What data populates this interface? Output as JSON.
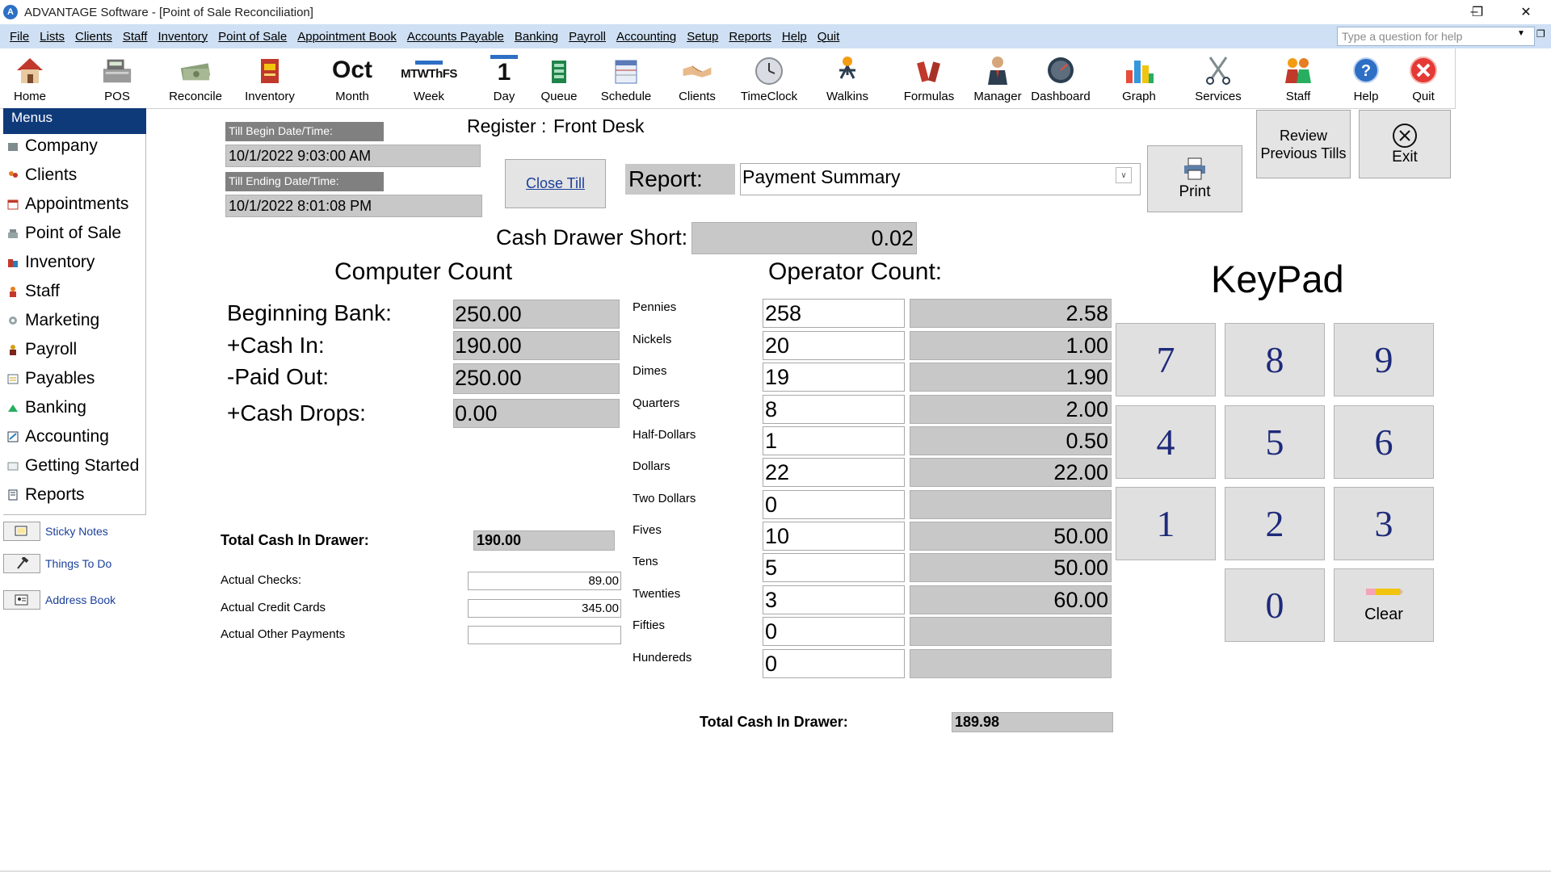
{
  "window": {
    "title": "ADVANTAGE Software - [Point of Sale Reconciliation]"
  },
  "menubar": {
    "items": [
      "File",
      "Lists",
      "Clients",
      "Staff",
      "Inventory",
      "Point of Sale",
      "Appointment Book",
      "Accounts Payable",
      "Banking",
      "Payroll",
      "Accounting",
      "Setup",
      "Reports",
      "Help",
      "Quit"
    ],
    "help_placeholder": "Type a question for help"
  },
  "toolbar": {
    "items": [
      {
        "label": "Home",
        "icon": "home-icon"
      },
      {
        "label": "POS",
        "icon": "cash-register-icon"
      },
      {
        "label": "Reconcile",
        "icon": "money-stack-icon"
      },
      {
        "label": "Inventory",
        "icon": "inventory-box-icon"
      },
      {
        "label": "Month",
        "icon": "month-calendar-icon",
        "icon_text": "Oct"
      },
      {
        "label": "Week",
        "icon": "week-calendar-icon",
        "icon_text": "MTWThFS"
      },
      {
        "label": "Day",
        "icon": "day-calendar-icon",
        "icon_text": "1"
      },
      {
        "label": "Queue",
        "icon": "queue-icon"
      },
      {
        "label": "Schedule",
        "icon": "schedule-icon"
      },
      {
        "label": "Clients",
        "icon": "handshake-icon"
      },
      {
        "label": "TimeClock",
        "icon": "clock-icon"
      },
      {
        "label": "Walkins",
        "icon": "walkin-icon"
      },
      {
        "label": "Formulas",
        "icon": "formula-bottles-icon"
      },
      {
        "label": "Manager",
        "icon": "manager-person-icon"
      },
      {
        "label": "Dashboard",
        "icon": "gauge-icon"
      },
      {
        "label": "Graph",
        "icon": "bar-graph-icon"
      },
      {
        "label": "Services",
        "icon": "scissors-icon"
      },
      {
        "label": "Staff",
        "icon": "staff-people-icon"
      },
      {
        "label": "Help",
        "icon": "help-icon"
      },
      {
        "label": "Quit",
        "icon": "quit-icon"
      }
    ]
  },
  "sidebar": {
    "header": "Menus",
    "items": [
      "Company",
      "Clients",
      "Appointments",
      "Point of Sale",
      "Inventory",
      "Staff",
      "Marketing",
      "Payroll",
      "Payables",
      "Banking",
      "Accounting",
      "Getting Started",
      "Reports"
    ],
    "shortcuts": [
      "Sticky Notes",
      "Things To Do",
      "Address Book"
    ]
  },
  "till": {
    "begin_label": "Till Begin Date/Time:",
    "begin_value": "10/1/2022 9:03:00 AM",
    "end_label": "Till Ending Date/Time:",
    "end_value": "10/1/2022 8:01:08 PM"
  },
  "register": {
    "label": "Register :",
    "value": "Front Desk"
  },
  "close_till": "Close Till",
  "report": {
    "label": "Report:",
    "value": "Payment Summary"
  },
  "print": "Print",
  "review_previous": "Review Previous Tills",
  "exit": "Exit",
  "cash_short": {
    "label": "Cash Drawer Short:",
    "value": "0.02"
  },
  "computer_count": {
    "title": "Computer Count",
    "rows": [
      {
        "label": "Beginning Bank:",
        "value": "250.00"
      },
      {
        "label": "+Cash In:",
        "value": "190.00"
      },
      {
        "label": "-Paid Out:",
        "value": "250.00"
      },
      {
        "label": "+Cash Drops:",
        "value": "0.00"
      }
    ],
    "total_label": "Total Cash In Drawer:",
    "total_value": "190.00",
    "checks_label": "Actual Checks:",
    "checks_value": "89.00",
    "cards_label": "Actual Credit Cards",
    "cards_value": "345.00",
    "other_label": "Actual Other Payments",
    "other_value": ""
  },
  "operator_count": {
    "title": "Operator Count:",
    "rows": [
      {
        "label": "Pennies",
        "count": "258",
        "amount": "2.58"
      },
      {
        "label": "Nickels",
        "count": "20",
        "amount": "1.00"
      },
      {
        "label": "Dimes",
        "count": "19",
        "amount": "1.90"
      },
      {
        "label": "Quarters",
        "count": "8",
        "amount": "2.00"
      },
      {
        "label": "Half-Dollars",
        "count": "1",
        "amount": "0.50"
      },
      {
        "label": "Dollars",
        "count": "22",
        "amount": "22.00"
      },
      {
        "label": "Two Dollars",
        "count": "0",
        "amount": ""
      },
      {
        "label": "Fives",
        "count": "10",
        "amount": "50.00"
      },
      {
        "label": "Tens",
        "count": "5",
        "amount": "50.00"
      },
      {
        "label": "Twenties",
        "count": "3",
        "amount": "60.00"
      },
      {
        "label": "Fifties",
        "count": "0",
        "amount": ""
      },
      {
        "label": "Hundereds",
        "count": "0",
        "amount": ""
      }
    ],
    "total_label": "Total Cash In Drawer:",
    "total_value": "189.98"
  },
  "keypad": {
    "title": "KeyPad",
    "keys": [
      "7",
      "8",
      "9",
      "4",
      "5",
      "6",
      "1",
      "2",
      "3",
      "0"
    ],
    "clear": "Clear"
  }
}
